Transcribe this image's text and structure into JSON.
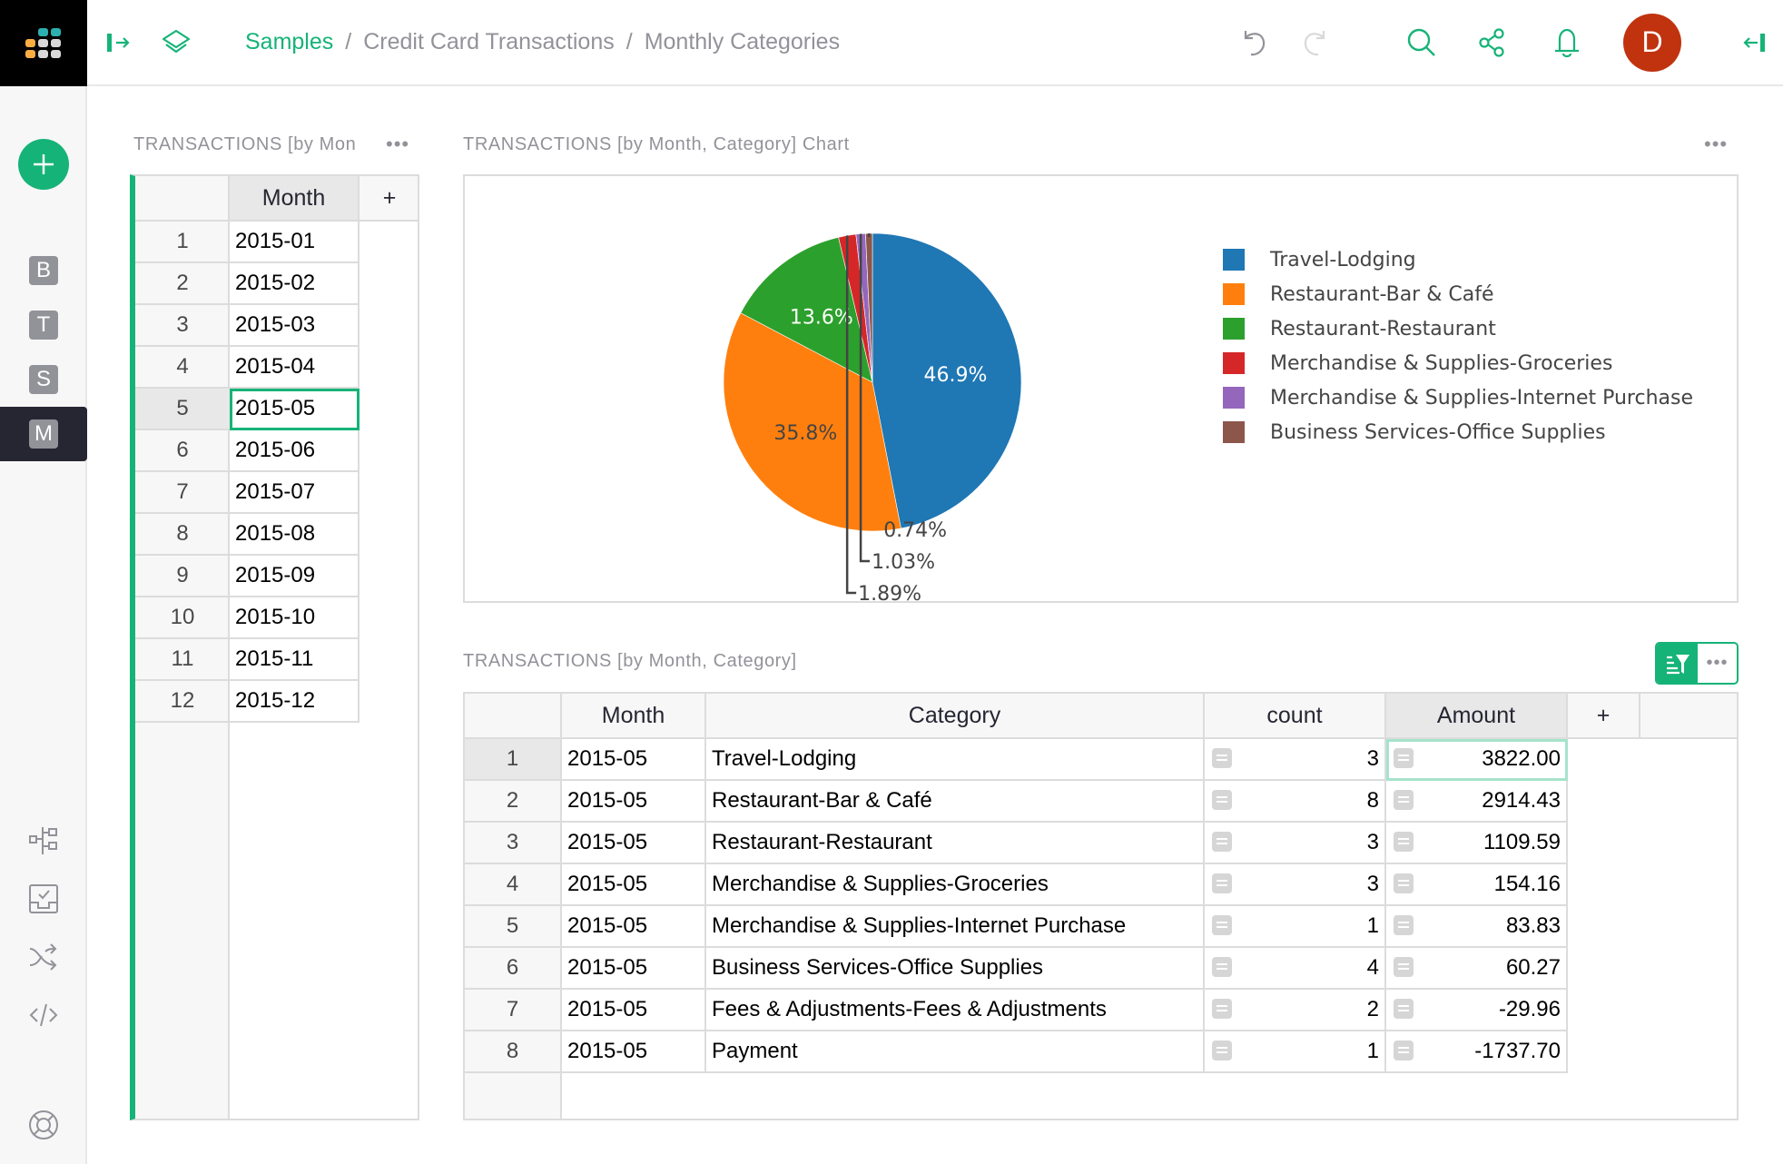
{
  "topbar": {
    "breadcrumb": [
      "Samples",
      "Credit Card Transactions",
      "Monthly Categories"
    ],
    "avatar_initial": "D",
    "icons": [
      "undo-icon",
      "redo-icon",
      "search-icon",
      "share-icon",
      "notification-bell-icon",
      "collapse-right-panel-icon"
    ]
  },
  "leftpanel": {
    "add_button_icon": "plus-icon",
    "pages": [
      {
        "letter": "B",
        "active": false
      },
      {
        "letter": "T",
        "active": false
      },
      {
        "letter": "S",
        "active": false
      },
      {
        "letter": "M",
        "active": true
      }
    ],
    "tools": [
      "raw-data-icon",
      "document-settings-icon",
      "workflow-icon",
      "code-view-icon",
      "help-center-icon"
    ]
  },
  "months_widget": {
    "title": "TRANSACTIONS [by Mon",
    "column": "Month",
    "add_column_label": "+",
    "rows": [
      "2015-01",
      "2015-02",
      "2015-03",
      "2015-04",
      "2015-05",
      "2015-06",
      "2015-07",
      "2015-08",
      "2015-09",
      "2015-10",
      "2015-11",
      "2015-12"
    ],
    "selected_row": 5
  },
  "chart_widget": {
    "title": "TRANSACTIONS [by Month, Category] Chart",
    "menu_label": "•••"
  },
  "chart_data": {
    "type": "pie",
    "title": "",
    "categories": [
      "Travel-Lodging",
      "Restaurant-Bar & Café",
      "Restaurant-Restaurant",
      "Merchandise & Supplies-Groceries",
      "Merchandise & Supplies-Internet Purchase",
      "Business Services-Office Supplies"
    ],
    "values": [
      3822.0,
      2914.43,
      1109.59,
      154.16,
      83.83,
      60.27
    ],
    "percent_labels": [
      "46.9%",
      "35.8%",
      "13.6%",
      "1.89%",
      "1.03%",
      "0.74%"
    ],
    "colors": [
      "#1f77b4",
      "#ff7f0e",
      "#2ca02c",
      "#d62728",
      "#9467bd",
      "#8c564b"
    ],
    "legend_position": "right"
  },
  "table_widget": {
    "title": "TRANSACTIONS [by Month, Category]",
    "menu_label": "•••",
    "columns": [
      "Month",
      "Category",
      "count",
      "Amount"
    ],
    "add_column_label": "+",
    "rows": [
      {
        "n": "1",
        "month": "2015-05",
        "category": "Travel-Lodging",
        "count": "3",
        "amount": "3822.00"
      },
      {
        "n": "2",
        "month": "2015-05",
        "category": "Restaurant-Bar & Café",
        "count": "8",
        "amount": "2914.43"
      },
      {
        "n": "3",
        "month": "2015-05",
        "category": "Restaurant-Restaurant",
        "count": "3",
        "amount": "1109.59"
      },
      {
        "n": "4",
        "month": "2015-05",
        "category": "Merchandise & Supplies-Groceries",
        "count": "3",
        "amount": "154.16"
      },
      {
        "n": "5",
        "month": "2015-05",
        "category": "Merchandise & Supplies-Internet Purchase",
        "count": "1",
        "amount": "83.83"
      },
      {
        "n": "6",
        "month": "2015-05",
        "category": "Business Services-Office Supplies",
        "count": "4",
        "amount": "60.27"
      },
      {
        "n": "7",
        "month": "2015-05",
        "category": "Fees & Adjustments-Fees & Adjustments",
        "count": "2",
        "amount": "-29.96"
      },
      {
        "n": "8",
        "month": "2015-05",
        "category": "Payment",
        "count": "1",
        "amount": "-1737.70"
      }
    ]
  },
  "colors": {
    "accent": "#16b378",
    "avatar": "#c0330e",
    "sidebar_active": "#262633"
  }
}
